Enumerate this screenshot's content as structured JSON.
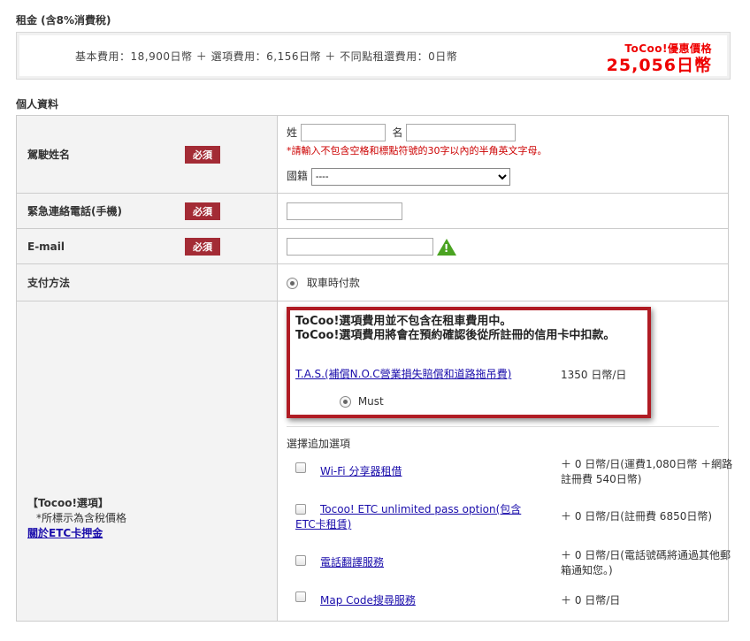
{
  "rent": {
    "section_title": "租金 (含8%消費稅)",
    "breakdown": "基本費用：18,900日幣 ＋ 選項費用：6,156日幣 ＋ 不同點租還費用：0日幣",
    "deal_label": "ToCoo!優惠價格",
    "deal_price": "25,056日幣"
  },
  "personal": {
    "section_title": "個人資料",
    "required_badge": "必須",
    "driver_name": {
      "label": "駕駛姓名",
      "surname_label": "姓",
      "given_label": "名",
      "note": "*請輸入不包含空格和標點符號的30字以內的半角英文字母。",
      "nationality_label": "國籍",
      "nationality_value": "----"
    },
    "phone": {
      "label": "緊急連絡電話(手機)"
    },
    "email": {
      "label": "E-mail"
    },
    "payment": {
      "label": "支付方法",
      "option": "取車時付款"
    }
  },
  "options": {
    "label": "【Tocoo!選項】",
    "sublabel": "*所標示為含稅價格",
    "etc_link": "關於ETC卡押金",
    "notice_line1": "ToCoo!選項費用並不包含在租車費用中。",
    "notice_line2": "ToCoo!選項費用將會在預約確認後從所註冊的信用卡中扣款。",
    "tas_link": "T.A.S.(補償N.O.C營業損失賠償和道路拖吊費)",
    "tas_price": "1350 日幣/日",
    "tas_must": "Must",
    "extra_title": "選擇追加選項",
    "extras": [
      {
        "name": "Wi-Fi 分享器租借",
        "price": "＋ 0 日幣/日(運費1,080日幣 ＋網路註冊費 540日幣)"
      },
      {
        "name": "Tocoo! ETC unlimited pass option(包含ETC卡租賃)",
        "price": "＋ 0 日幣/日(註冊費 6850日幣)"
      },
      {
        "name": "電話翻譯服務",
        "price": "＋ 0 日幣/日(電話號碼將通過其他郵箱通知您。)"
      },
      {
        "name": "Map Code搜尋服務",
        "price": "＋ 0 日幣/日"
      }
    ]
  },
  "colors": {
    "accent_red": "#e00000",
    "badge": "#a32b35",
    "frame": "#b01c24",
    "link": "#1a0dab"
  }
}
